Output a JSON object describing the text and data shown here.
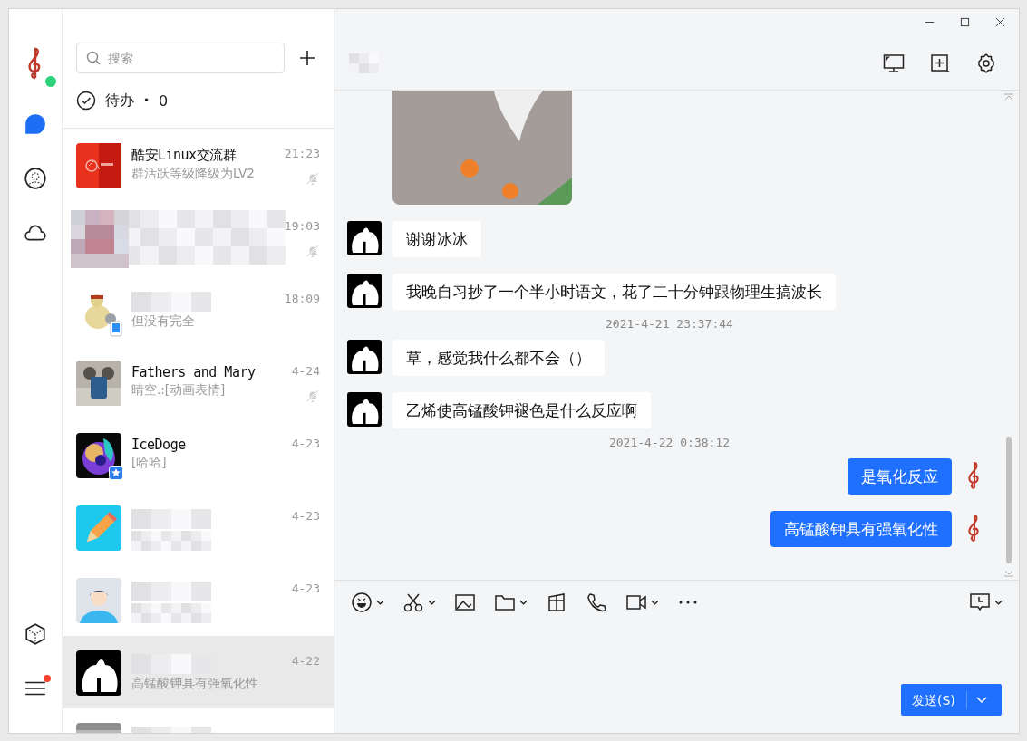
{
  "rail": {
    "online": true,
    "items": [
      {
        "kind": "chat",
        "selected": true
      },
      {
        "kind": "contacts",
        "selected": false
      },
      {
        "kind": "cloud",
        "selected": false
      }
    ],
    "bottom": [
      {
        "kind": "apps",
        "badge": false
      },
      {
        "kind": "menu",
        "badge": true
      }
    ]
  },
  "search": {
    "placeholder": "搜索"
  },
  "todo": {
    "label": "待办",
    "separator": "•",
    "count": "0"
  },
  "conversations": [
    {
      "name": "酷安Linux交流群",
      "name_blurred": false,
      "preview": "群活跃等级降级为LV2",
      "preview_blurred": false,
      "time": "21:23",
      "muted": true,
      "selected": false
    },
    {
      "name_blurred": true,
      "preview_blurred": true,
      "time": "19:03",
      "muted": true,
      "selected": false
    },
    {
      "badge": {
        "kind": "phone"
      },
      "name_blurred": true,
      "preview": "但没有完全",
      "preview_blurred": false,
      "time": "18:09",
      "muted": false,
      "selected": false
    },
    {
      "name": "Fathers and Mary",
      "name_blurred": false,
      "preview": "晴空.:[动画表情]",
      "preview_blurred": false,
      "time": "4-24",
      "muted": true,
      "selected": false
    },
    {
      "badge": {
        "kind": "star"
      },
      "name": "IceDoge",
      "name_blurred": false,
      "preview": "[哈哈]",
      "preview_blurred": false,
      "time": "4-23",
      "muted": false,
      "selected": false
    },
    {
      "name_blurred": true,
      "preview_blurred": true,
      "time": "4-23",
      "muted": false,
      "selected": false
    },
    {
      "name_blurred": true,
      "preview_blurred": true,
      "time": "4-23",
      "muted": false,
      "selected": false
    },
    {
      "name_blurred": true,
      "preview": "高锰酸钾具有强氧化性",
      "preview_blurred": false,
      "time": "4-22",
      "muted": false,
      "selected": true
    },
    {
      "name_blurred": true,
      "preview_blurred": false,
      "muted": false,
      "selected": false
    }
  ],
  "chat": {
    "title_blurred": true,
    "messages": [
      {
        "kind": "sticker",
        "self": false
      },
      {
        "kind": "text",
        "self": false,
        "text": "谢谢冰冰"
      },
      {
        "kind": "text",
        "self": false,
        "text": "我晚自习抄了一个半小时语文，花了二十分钟跟物理生搞波长"
      },
      {
        "kind": "time",
        "text": "2021-4-21 23:37:44"
      },
      {
        "kind": "text",
        "self": false,
        "text": "草，感觉我什么都不会（）"
      },
      {
        "kind": "text",
        "self": false,
        "text": "乙烯使高锰酸钾褪色是什么反应啊"
      },
      {
        "kind": "time",
        "text": "2021-4-22 0:38:12"
      },
      {
        "kind": "text",
        "self": true,
        "text": "是氧化反应"
      },
      {
        "kind": "text",
        "self": true,
        "text": "高锰酸钾具有强氧化性"
      }
    ]
  },
  "compose": {
    "send": "发送(S)"
  }
}
